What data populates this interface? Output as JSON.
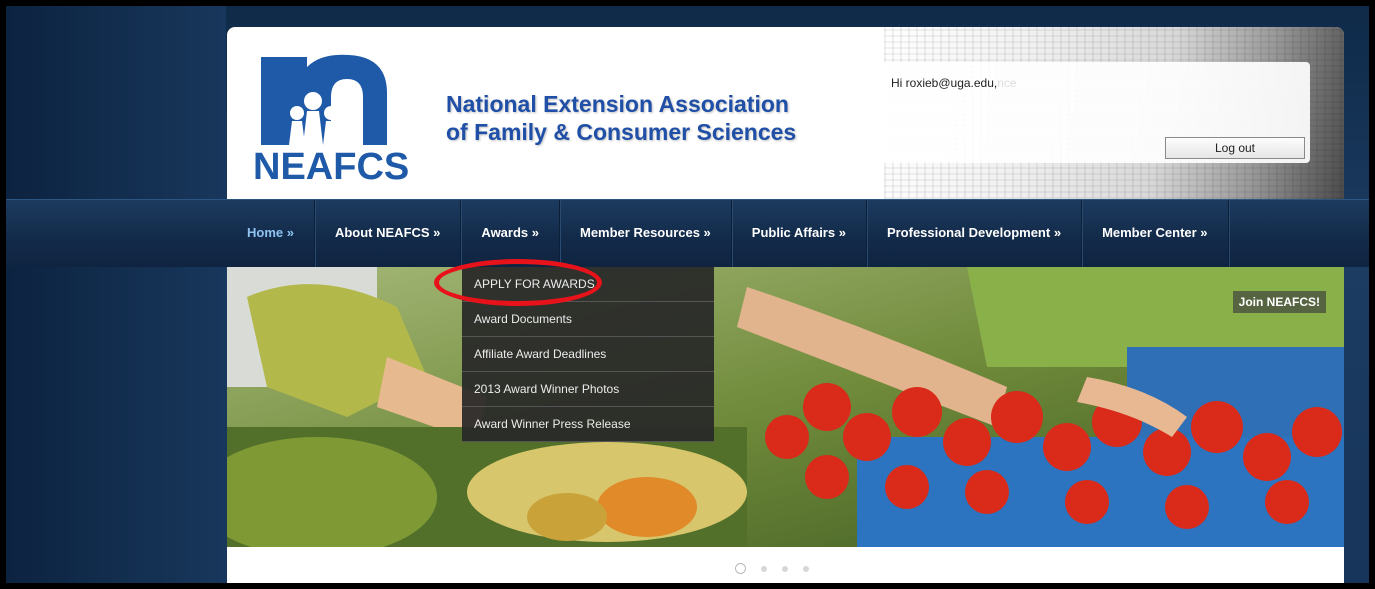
{
  "header": {
    "org_line1": "National Extension Association",
    "org_line2": "of Family & Consumer Sciences",
    "logo_text": "NEAFCS",
    "greeting": "Hi roxieb@uga.edu,",
    "greeting_faded": "nce",
    "logout_label": "Log out"
  },
  "nav": {
    "items": [
      {
        "label": "Home »"
      },
      {
        "label": "About NEAFCS »"
      },
      {
        "label": "Awards »"
      },
      {
        "label": "Member Resources »"
      },
      {
        "label": "Public Affairs »"
      },
      {
        "label": "Professional Development »"
      },
      {
        "label": "Member Center »"
      }
    ]
  },
  "dropdown": {
    "items": [
      {
        "label": "APPLY FOR AWARDS"
      },
      {
        "label": "Award Documents"
      },
      {
        "label": "Affiliate Award Deadlines"
      },
      {
        "label": "2013 Award Winner Photos"
      },
      {
        "label": "Award Winner Press Release"
      }
    ]
  },
  "hero": {
    "join_label": "Join NEAFCS!",
    "slide_count": 4,
    "active_slide": 1
  },
  "colors": {
    "nav_bg": "#132b4a",
    "logo_blue": "#1f4fa6",
    "highlight_red": "#e8131a"
  }
}
